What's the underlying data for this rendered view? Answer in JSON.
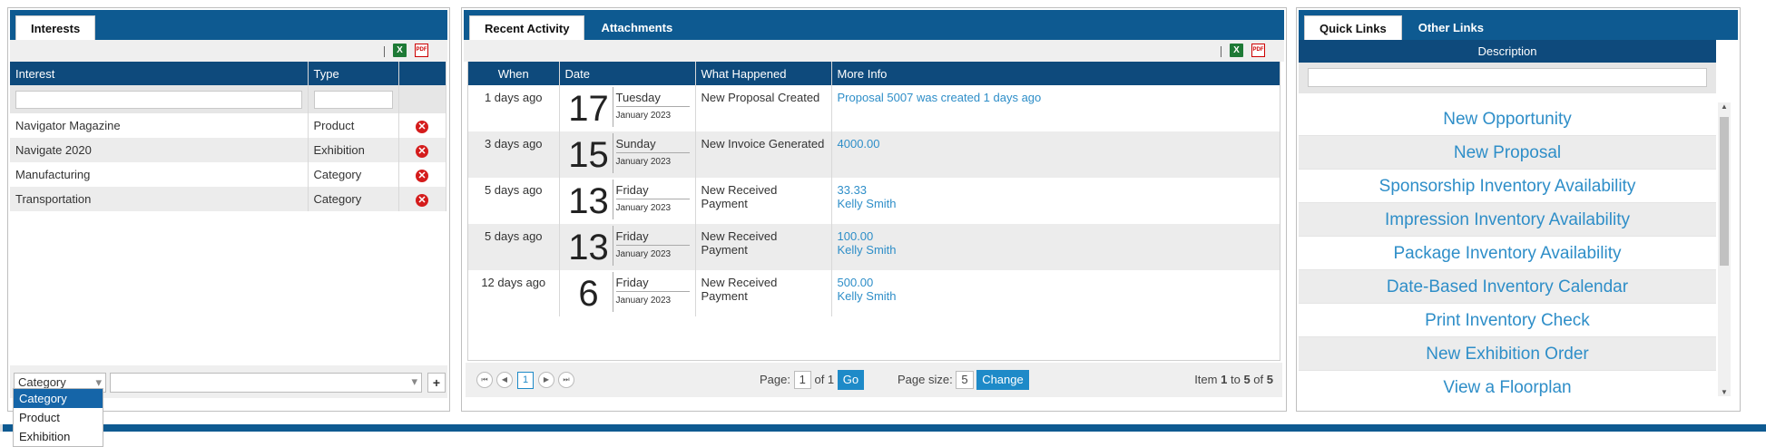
{
  "interests": {
    "tab_label": "Interests",
    "columns": [
      "Interest",
      "Type"
    ],
    "rows": [
      {
        "interest": "Navigator Magazine",
        "type": "Product"
      },
      {
        "interest": "Navigate 2020",
        "type": "Exhibition"
      },
      {
        "interest": "Manufacturing",
        "type": "Category"
      },
      {
        "interest": "Transportation",
        "type": "Category"
      }
    ],
    "add_select_value": "Category",
    "add_button": "+",
    "dropdown_options": [
      "Category",
      "Product",
      "Exhibition"
    ]
  },
  "activity": {
    "tabs": [
      "Recent Activity",
      "Attachments"
    ],
    "columns": [
      "When",
      "Date",
      "What Happened",
      "More Info"
    ],
    "rows": [
      {
        "when": "1 days ago",
        "day": "17",
        "weekday": "Tuesday",
        "monthyear": "January 2023",
        "what": "New Proposal Created",
        "info1": "Proposal 5007 was created 1 days ago",
        "info2": ""
      },
      {
        "when": "3 days ago",
        "day": "15",
        "weekday": "Sunday",
        "monthyear": "January 2023",
        "what": "New Invoice Generated",
        "info1": "4000.00",
        "info2": ""
      },
      {
        "when": "5 days ago",
        "day": "13",
        "weekday": "Friday",
        "monthyear": "January 2023",
        "what": "New Received Payment",
        "info1": "33.33",
        "info2": "Kelly Smith"
      },
      {
        "when": "5 days ago",
        "day": "13",
        "weekday": "Friday",
        "monthyear": "January 2023",
        "what": "New Received Payment",
        "info1": "100.00",
        "info2": "Kelly Smith"
      },
      {
        "when": "12 days ago",
        "day": "6",
        "weekday": "Friday",
        "monthyear": "January 2023",
        "what": "New Received Payment",
        "info1": "500.00",
        "info2": "Kelly Smith"
      }
    ],
    "pager": {
      "current_page": "1",
      "page_label": "Page:",
      "page_value": "1",
      "of_label": "of 1",
      "go_label": "Go",
      "size_label": "Page size:",
      "size_value": "5",
      "change_label": "Change",
      "item_prefix": "Item",
      "item_from": "1",
      "item_to_label": "to",
      "item_to": "5",
      "item_of_label": "of",
      "item_total": "5"
    }
  },
  "links": {
    "tabs": [
      "Quick Links",
      "Other Links"
    ],
    "header": "Description",
    "items": [
      "New Opportunity",
      "New Proposal",
      "Sponsorship Inventory Availability",
      "Impression Inventory Availability",
      "Package Inventory Availability",
      "Date-Based Inventory Calendar",
      "Print Inventory Check",
      "New Exhibition Order",
      "View a Floorplan"
    ]
  },
  "icons": {
    "excel": "X",
    "pdf": "PDF",
    "delete": "✕",
    "first": "⏮",
    "prev": "◀",
    "next": "▶",
    "last": "⏭",
    "dropdown": "▾"
  },
  "colors": {
    "header_blue": "#0e4a7c",
    "tab_blue": "#0e5a91",
    "link_blue": "#2e8ec8",
    "button_blue": "#1e8ac8",
    "delete_red": "#d41c1c"
  }
}
